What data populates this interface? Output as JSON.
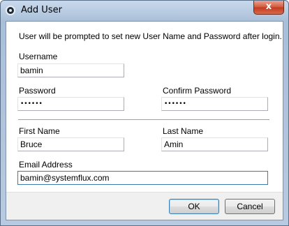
{
  "window": {
    "title": "Add User",
    "close_label": "x",
    "app_icon": "app-circle-icon"
  },
  "form": {
    "info_text": "User will be prompted to set new User Name and Password after login.",
    "username": {
      "label": "Username",
      "value": "bamin"
    },
    "password": {
      "label": "Password",
      "value": "••••••"
    },
    "confirm_password": {
      "label": "Confirm Password",
      "value": "••••••"
    },
    "first_name": {
      "label": "First Name",
      "value": "Bruce"
    },
    "last_name": {
      "label": "Last Name",
      "value": "Amin"
    },
    "email": {
      "label": "Email Address",
      "value": "bamin@systemflux.com"
    }
  },
  "buttons": {
    "ok": "OK",
    "cancel": "Cancel"
  }
}
